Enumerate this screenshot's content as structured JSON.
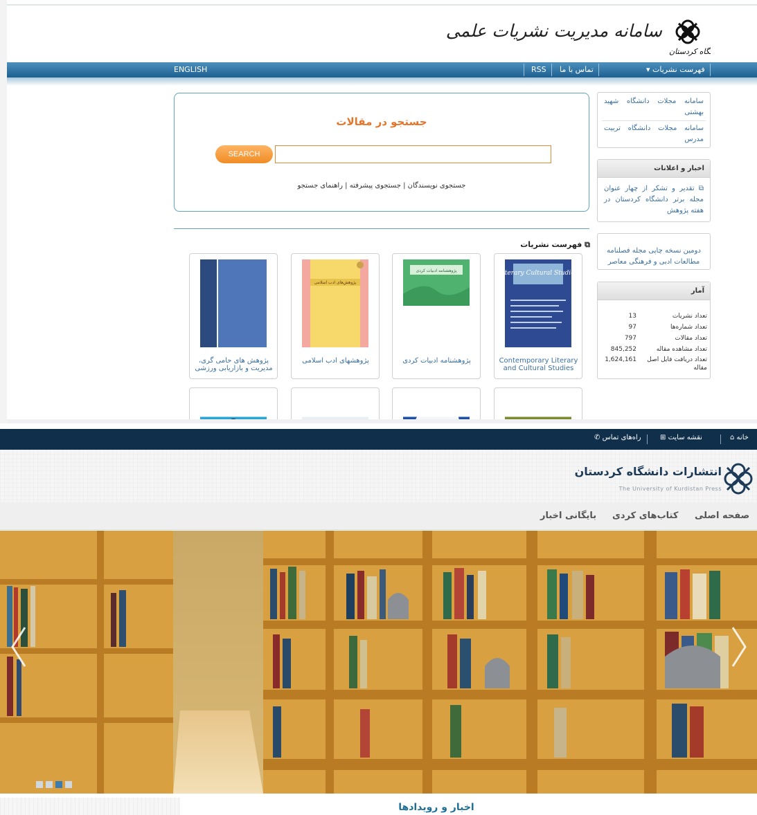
{
  "portal": {
    "title": "سامانه مدیریت نشریات علمی",
    "logo_caption": "دانشگاه کردستان",
    "nav": {
      "journals_menu": "فهرست نشریات",
      "contact": "تماس با ما",
      "rss": "RSS",
      "english": "ENGLISH"
    },
    "sidebar": {
      "links": [
        "سامانه مجلات دانشگاه شهید بهشتی",
        "سامانه مجلات دانشگاه تربیت مدرس"
      ],
      "news_heading": "اخبار و اعلانات",
      "news_items": [
        "تقدیر و تشکر از چهار عنوان مجله برتر دانشگاه کردستان در هفته پژوهش"
      ],
      "notice": "دومین نسخه چاپی مجله فصلنامه مطالعات ادبی و فرهنگی معاصر",
      "stats_heading": "آمار",
      "stats": [
        {
          "label": "تعداد نشریات",
          "value": "13"
        },
        {
          "label": "تعداد شماره‌ها",
          "value": "97"
        },
        {
          "label": "تعداد مقالات",
          "value": "797"
        },
        {
          "label": "تعداد مشاهده مقاله",
          "value": "845,252"
        },
        {
          "label": "تعداد دریافت فایل اصل مقاله",
          "value": "1,624,161"
        }
      ]
    },
    "search": {
      "heading": "جستجو در مقالات",
      "button": "SEARCH",
      "placeholder": "",
      "links": [
        "جستجوی نویسندگان",
        "جستجوی پیشرفته",
        "راهنمای جستجو"
      ]
    },
    "journals_heading": "فهرست نشریات",
    "journals": [
      {
        "title": "Contemporary Literary and Cultural Studies",
        "cover_text": "Literary Cultural Studies",
        "color": "#2d4a93"
      },
      {
        "title": "پژوهشنامه ادبیات کردی",
        "cover_text": "پژوهشنامه ادبیات کردی",
        "color": "#4fb26e"
      },
      {
        "title": "پژوهشهای ادب اسلامی",
        "cover_text": "پژوهش‌های ادب اسلامی",
        "color": "#f7d86a"
      },
      {
        "title": "پژوهش های حامی گری، مدیریت و بازاریابی ورزشی",
        "cover_text": "",
        "color": "#4f76b8"
      }
    ]
  },
  "press": {
    "topbar": {
      "home": "خانه",
      "sitemap": "نقشه سایت",
      "contact": "راه‌های تماس"
    },
    "name": "انتشارات دانشگاه کردستان",
    "name_en": "The University of Kurdistan Press",
    "nav": [
      "صفحه اصلی",
      "کتاب‌های کردی",
      "بایگانی اخبار"
    ],
    "news_heading": "اخبار و رویدادها"
  }
}
